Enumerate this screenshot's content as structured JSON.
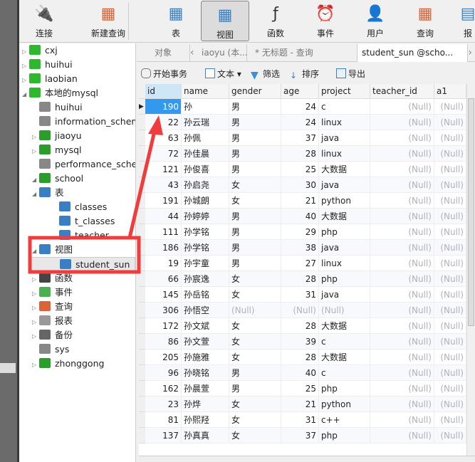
{
  "toolbar": {
    "items": [
      {
        "label": "连接",
        "icon": "connect-icon"
      },
      {
        "label": "新建查询",
        "icon": "new-query-icon"
      },
      {
        "label": "表",
        "icon": "table-icon"
      },
      {
        "label": "视图",
        "icon": "view-icon",
        "active": true
      },
      {
        "label": "函数",
        "icon": "function-icon"
      },
      {
        "label": "事件",
        "icon": "event-clock-icon"
      },
      {
        "label": "用户",
        "icon": "user-icon"
      },
      {
        "label": "查询",
        "icon": "query-icon"
      },
      {
        "label": "报",
        "icon": "report-icon"
      }
    ]
  },
  "sidebar": {
    "items": [
      {
        "label": "cxj",
        "level": 0,
        "arrow": "▷",
        "icon": "connection-icon",
        "color": "#2eb82e"
      },
      {
        "label": "huihui",
        "level": 0,
        "arrow": "▷",
        "icon": "connection-icon",
        "color": "#2eb82e"
      },
      {
        "label": "laobian",
        "level": 0,
        "arrow": "▷",
        "icon": "connection-icon",
        "color": "#2eb82e"
      },
      {
        "label": "本地的mysql",
        "level": 0,
        "arrow": "◢",
        "icon": "connection-icon",
        "color": "#2eb82e"
      },
      {
        "label": "huihui",
        "level": 1,
        "arrow": "",
        "icon": "database-icon",
        "color": "#888"
      },
      {
        "label": "information_schem",
        "level": 1,
        "arrow": "",
        "icon": "database-icon",
        "color": "#888"
      },
      {
        "label": "jiaoyu",
        "level": 1,
        "arrow": "▷",
        "icon": "database-icon",
        "color": "#2a9d2a"
      },
      {
        "label": "mysql",
        "level": 1,
        "arrow": "▷",
        "icon": "database-icon",
        "color": "#2a9d2a"
      },
      {
        "label": "performance_scher",
        "level": 1,
        "arrow": "",
        "icon": "database-icon",
        "color": "#888"
      },
      {
        "label": "school",
        "level": 1,
        "arrow": "◢",
        "icon": "database-icon",
        "color": "#2a9d2a"
      },
      {
        "label": "表",
        "level": 2,
        "arrow": "◢",
        "icon": "table-icon",
        "color": "#3a7fc4"
      },
      {
        "label": "classes",
        "level": 3,
        "arrow": "",
        "icon": "table-icon",
        "color": "#3a7fc4"
      },
      {
        "label": "t_classes",
        "level": 3,
        "arrow": "",
        "icon": "table-icon",
        "color": "#3a7fc4"
      },
      {
        "label": "teacher",
        "level": 3,
        "arrow": "",
        "icon": "table-icon",
        "color": "#3a7fc4"
      },
      {
        "label": "视图",
        "level": 2,
        "arrow": "◢",
        "icon": "view-icon",
        "color": "#3a7fc4"
      },
      {
        "label": "student_sun",
        "level": 3,
        "arrow": "",
        "icon": "view-icon",
        "color": "#3a7fc4",
        "selected": true
      },
      {
        "label": "函数",
        "level": 2,
        "arrow": "▷",
        "icon": "function-icon",
        "color": "#444"
      },
      {
        "label": "事件",
        "level": 2,
        "arrow": "▷",
        "icon": "event-clock-icon",
        "color": "#4caf50"
      },
      {
        "label": "查询",
        "level": 2,
        "arrow": "▷",
        "icon": "query-icon",
        "color": "#d9643a"
      },
      {
        "label": "报表",
        "level": 2,
        "arrow": "▷",
        "icon": "report-icon",
        "color": "#999"
      },
      {
        "label": "备份",
        "level": 2,
        "arrow": "▷",
        "icon": "backup-icon",
        "color": "#666"
      },
      {
        "label": "sys",
        "level": 1,
        "arrow": "",
        "icon": "database-icon",
        "color": "#888"
      },
      {
        "label": "zhonggong",
        "level": 1,
        "arrow": "▷",
        "icon": "database-icon",
        "color": "#2a9d2a"
      }
    ]
  },
  "tabs": [
    {
      "label": "对象"
    },
    {
      "label": "iaoyu (本..."
    },
    {
      "label": "* 无标题 - 查询"
    },
    {
      "label": "student_sun @scho...",
      "active": true
    }
  ],
  "subtoolbar": {
    "begin_transaction": "开始事务",
    "text": "文本",
    "filter": "筛选",
    "sort": "排序",
    "export": "导出"
  },
  "grid": {
    "columns": [
      "id",
      "name",
      "gender",
      "age",
      "project",
      "teacher_id",
      "a1"
    ],
    "null_text": "(Null)",
    "rows": [
      [
        190,
        "孙",
        "男",
        24,
        "c",
        null,
        null
      ],
      [
        22,
        "孙云瑞",
        "男",
        24,
        "linux",
        null,
        null
      ],
      [
        63,
        "孙佩",
        "男",
        37,
        "java",
        null,
        null
      ],
      [
        72,
        "孙佳晨",
        "男",
        28,
        "linux",
        null,
        null
      ],
      [
        121,
        "孙俊喜",
        "男",
        25,
        "大数据",
        null,
        null
      ],
      [
        43,
        "孙启尧",
        "女",
        30,
        "java",
        null,
        null
      ],
      [
        191,
        "孙城朗",
        "女",
        21,
        "python",
        null,
        null
      ],
      [
        44,
        "孙婷婷",
        "男",
        40,
        "大数据",
        null,
        null
      ],
      [
        111,
        "孙学铭",
        "男",
        29,
        "php",
        null,
        null
      ],
      [
        186,
        "孙学铭",
        "男",
        38,
        "java",
        null,
        null
      ],
      [
        19,
        "孙宇童",
        "男",
        27,
        "linux",
        null,
        null
      ],
      [
        66,
        "孙宸逸",
        "女",
        28,
        "php",
        null,
        null
      ],
      [
        145,
        "孙岳铭",
        "女",
        31,
        "java",
        null,
        null
      ],
      [
        306,
        "孙悟空",
        null,
        null,
        null,
        null,
        null
      ],
      [
        172,
        "孙文斌",
        "女",
        28,
        "大数据",
        null,
        null
      ],
      [
        86,
        "孙文萱",
        "女",
        39,
        "c",
        null,
        null
      ],
      [
        205,
        "孙施雅",
        "女",
        28,
        "大数据",
        null,
        null
      ],
      [
        96,
        "孙晓铭",
        "男",
        40,
        "c",
        null,
        null
      ],
      [
        162,
        "孙晨萱",
        "男",
        25,
        "php",
        null,
        null
      ],
      [
        23,
        "孙烨",
        "女",
        21,
        "python",
        null,
        null
      ],
      [
        81,
        "孙熙羟",
        "女",
        31,
        "c++",
        null,
        null
      ],
      [
        137,
        "孙真真",
        "女",
        37,
        "php",
        null,
        null
      ]
    ]
  },
  "annotation_color": "#f03c3c"
}
